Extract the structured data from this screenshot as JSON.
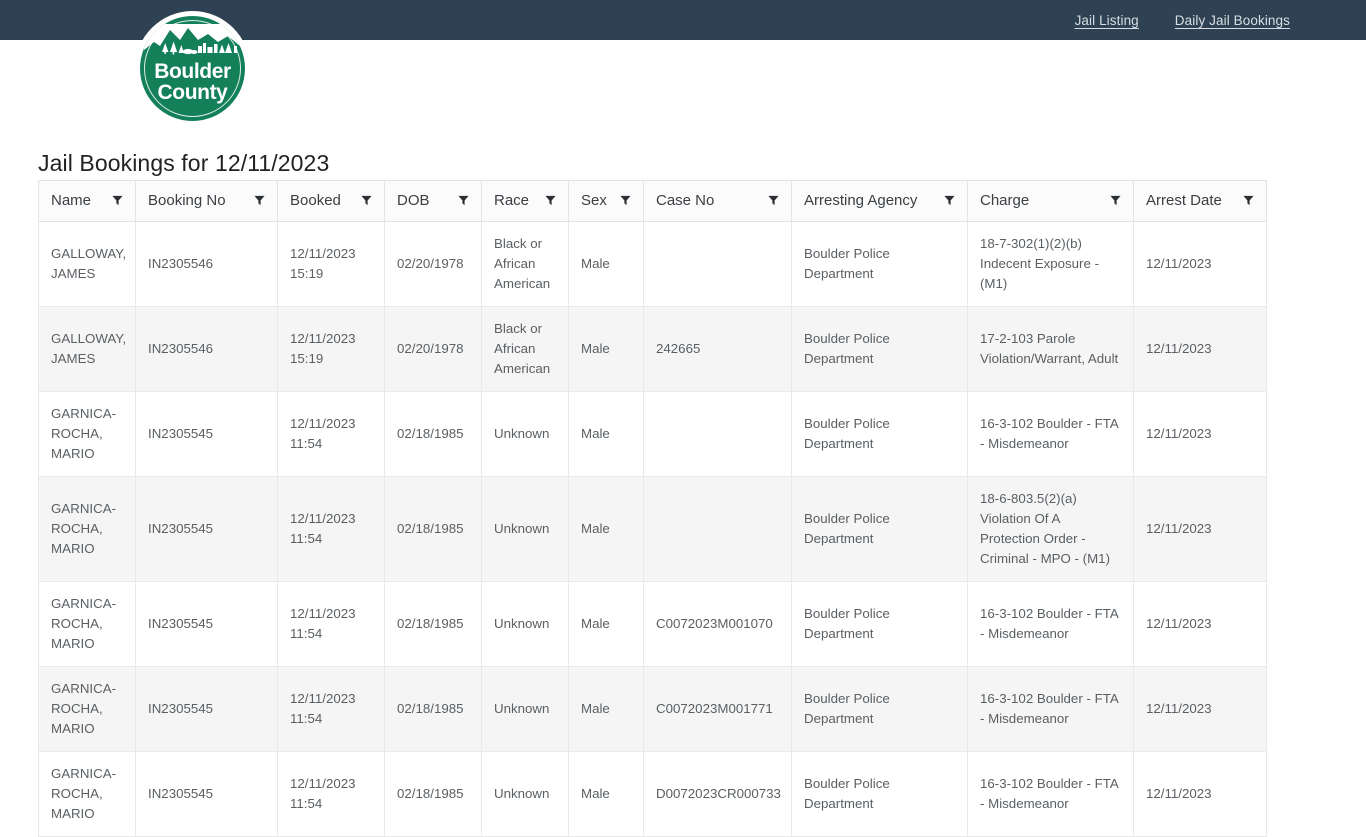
{
  "navbar": {
    "links": [
      {
        "label": "Jail Listing",
        "name": "jail-listing"
      },
      {
        "label": "Daily Jail Bookings",
        "name": "daily-jail-bookings"
      }
    ],
    "background_color": "#2e4253",
    "link_color": "#d8dee3"
  },
  "logo": {
    "line1": "Boulder",
    "line2": "County",
    "color": "#14805a"
  },
  "page": {
    "title": "Jail Bookings for 12/11/2023"
  },
  "table": {
    "filter_icon": "funnel-icon",
    "columns": [
      {
        "key": "name",
        "label": "Name"
      },
      {
        "key": "booking",
        "label": "Booking No"
      },
      {
        "key": "booked",
        "label": "Booked"
      },
      {
        "key": "dob",
        "label": "DOB"
      },
      {
        "key": "race",
        "label": "Race"
      },
      {
        "key": "sex",
        "label": "Sex"
      },
      {
        "key": "case",
        "label": "Case No"
      },
      {
        "key": "agency",
        "label": "Arresting Agency"
      },
      {
        "key": "charge",
        "label": "Charge"
      },
      {
        "key": "arrest",
        "label": "Arrest Date"
      }
    ],
    "rows": [
      {
        "name": "GALLOWAY, JAMES",
        "booking": "IN2305546",
        "booked": "12/11/2023 15:19",
        "dob": "02/20/1978",
        "race": "Black or African American",
        "sex": "Male",
        "case": "",
        "agency": "Boulder Police Department",
        "charge": "18-7-302(1)(2)(b) Indecent Exposure - (M1)",
        "arrest": "12/11/2023"
      },
      {
        "name": "GALLOWAY, JAMES",
        "booking": "IN2305546",
        "booked": "12/11/2023 15:19",
        "dob": "02/20/1978",
        "race": "Black or African American",
        "sex": "Male",
        "case": "242665",
        "agency": "Boulder Police Department",
        "charge": "17-2-103 Parole Violation/Warrant, Adult",
        "arrest": "12/11/2023"
      },
      {
        "name": "GARNICA-ROCHA, MARIO",
        "booking": "IN2305545",
        "booked": "12/11/2023 11:54",
        "dob": "02/18/1985",
        "race": "Unknown",
        "sex": "Male",
        "case": "",
        "agency": "Boulder Police Department",
        "charge": "16-3-102 Boulder - FTA - Misdemeanor",
        "arrest": "12/11/2023"
      },
      {
        "name": "GARNICA-ROCHA, MARIO",
        "booking": "IN2305545",
        "booked": "12/11/2023 11:54",
        "dob": "02/18/1985",
        "race": "Unknown",
        "sex": "Male",
        "case": "",
        "agency": "Boulder Police Department",
        "charge": "18-6-803.5(2)(a) Violation Of A Protection Order - Criminal - MPO - (M1)",
        "arrest": "12/11/2023"
      },
      {
        "name": "GARNICA-ROCHA, MARIO",
        "booking": "IN2305545",
        "booked": "12/11/2023 11:54",
        "dob": "02/18/1985",
        "race": "Unknown",
        "sex": "Male",
        "case": "C0072023M001070",
        "agency": "Boulder Police Department",
        "charge": "16-3-102 Boulder - FTA - Misdemeanor",
        "arrest": "12/11/2023"
      },
      {
        "name": "GARNICA-ROCHA, MARIO",
        "booking": "IN2305545",
        "booked": "12/11/2023 11:54",
        "dob": "02/18/1985",
        "race": "Unknown",
        "sex": "Male",
        "case": "C0072023M001771",
        "agency": "Boulder Police Department",
        "charge": "16-3-102 Boulder - FTA - Misdemeanor",
        "arrest": "12/11/2023"
      },
      {
        "name": "GARNICA-ROCHA, MARIO",
        "booking": "IN2305545",
        "booked": "12/11/2023 11:54",
        "dob": "02/18/1985",
        "race": "Unknown",
        "sex": "Male",
        "case": "D0072023CR000733",
        "agency": "Boulder Police Department",
        "charge": "16-3-102 Boulder - FTA - Misdemeanor",
        "arrest": "12/11/2023"
      }
    ]
  }
}
